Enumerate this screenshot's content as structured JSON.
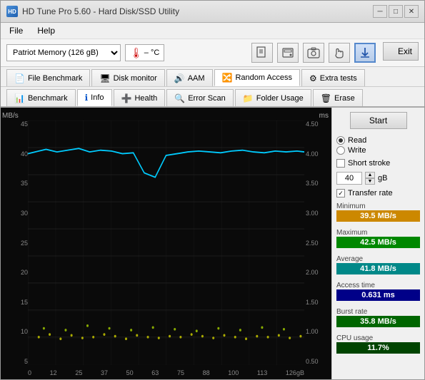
{
  "window": {
    "title": "HD Tune Pro 5.60 - Hard Disk/SSD Utility",
    "icon": "HD"
  },
  "menu": {
    "items": [
      "File",
      "Help"
    ]
  },
  "toolbar": {
    "device": "Patriot Memory (126 gB)",
    "temp_icon": "🌡",
    "temp_value": "– °C",
    "buttons": [
      {
        "id": "file-benchmark-icon",
        "icon": "📄",
        "label": ""
      },
      {
        "id": "disk-monitor-icon",
        "icon": "📊",
        "label": ""
      },
      {
        "id": "camera-icon",
        "icon": "📷",
        "label": ""
      },
      {
        "id": "download-icon",
        "icon": "📥",
        "label": ""
      },
      {
        "id": "arrow-down-icon",
        "icon": "⬇",
        "label": ""
      }
    ],
    "exit_label": "Exit"
  },
  "tabs_row1": [
    {
      "id": "file-benchmark",
      "label": "File Benchmark",
      "icon": "📄"
    },
    {
      "id": "disk-monitor",
      "label": "Disk monitor",
      "icon": "💻"
    },
    {
      "id": "aam",
      "label": "AAM",
      "icon": "🔊"
    },
    {
      "id": "random-access",
      "label": "Random Access",
      "icon": "🔀",
      "active": true
    },
    {
      "id": "extra-tests",
      "label": "Extra tests",
      "icon": "⚙"
    }
  ],
  "tabs_row2": [
    {
      "id": "benchmark",
      "label": "Benchmark",
      "icon": "📊"
    },
    {
      "id": "info",
      "label": "Info",
      "icon": "ℹ",
      "active": true
    },
    {
      "id": "health",
      "label": "Health",
      "icon": "❤"
    },
    {
      "id": "error-scan",
      "label": "Error Scan",
      "icon": "🔍"
    },
    {
      "id": "folder-usage",
      "label": "Folder Usage",
      "icon": "📁"
    },
    {
      "id": "erase",
      "label": "Erase",
      "icon": "🗑"
    }
  ],
  "chart": {
    "y_label_left": "MB/s",
    "y_label_right": "ms",
    "y_left_values": [
      "45",
      "40",
      "35",
      "30",
      "25",
      "20",
      "15",
      "10",
      "5"
    ],
    "y_right_values": [
      "4.50",
      "4.00",
      "3.50",
      "3.00",
      "2.50",
      "2.00",
      "1.50",
      "1.00",
      "0.50"
    ],
    "x_values": [
      "0",
      "12",
      "25",
      "37",
      "50",
      "63",
      "75",
      "88",
      "100",
      "113",
      "126gB"
    ]
  },
  "controls": {
    "start_label": "Start",
    "read_label": "Read",
    "write_label": "Write",
    "short_stroke_label": "Short stroke",
    "short_stroke_checked": false,
    "spinbox_value": "40",
    "spinbox_unit": "gB",
    "transfer_rate_label": "Transfer rate",
    "transfer_rate_checked": true
  },
  "stats": {
    "minimum_label": "Minimum",
    "minimum_value": "39.5 MB/s",
    "maximum_label": "Maximum",
    "maximum_value": "42.5 MB/s",
    "average_label": "Average",
    "average_value": "41.8 MB/s",
    "access_time_label": "Access time",
    "access_time_value": "0.631 ms",
    "burst_rate_label": "Burst rate",
    "burst_rate_value": "35.8 MB/s",
    "cpu_usage_label": "CPU usage",
    "cpu_usage_value": "11.7%"
  }
}
